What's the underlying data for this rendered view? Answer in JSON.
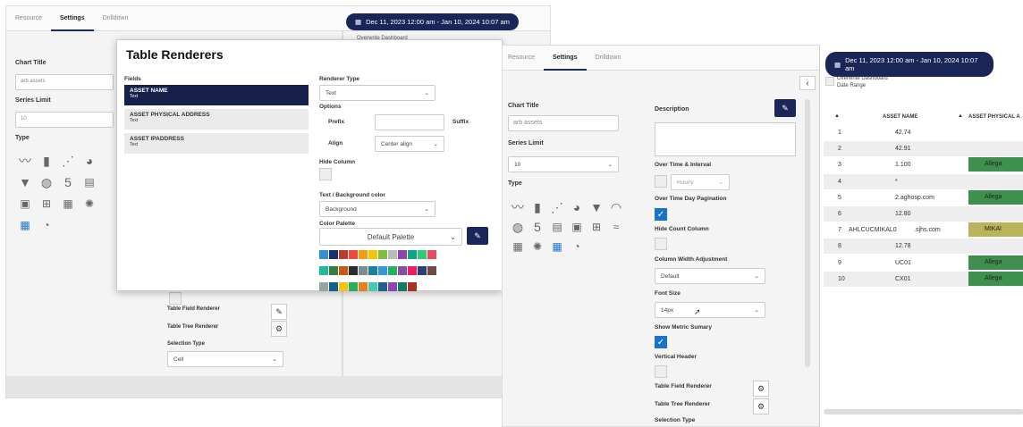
{
  "back": {
    "tabs": [
      "Resource",
      "Settings",
      "Drilldown"
    ],
    "date_range": "Dec 11, 2023 12:00 am - Jan 10, 2024 10:07 am",
    "overwrite": "Overwrite Dashboard",
    "chart_title_label": "Chart Title",
    "chart_title_value": "arb assets",
    "series_limit_label": "Series Limit",
    "series_limit_value": "10",
    "type_label": "Type",
    "table_field_renderer": "Table Field Renderer",
    "table_tree_renderer": "Table Tree Renderer",
    "selection_type": "Selection Type",
    "selection_value": "Cell"
  },
  "modal": {
    "title": "Table Renderers",
    "fields_label": "Fields",
    "fields": [
      {
        "name": "ASSET NAME",
        "type": "Text"
      },
      {
        "name": "ASSET PHYSICAL ADDRESS",
        "type": "Text"
      },
      {
        "name": "ASSET IPADDRESS",
        "type": "Text"
      }
    ],
    "renderer_type_label": "Renderer Type",
    "renderer_type_value": "Text",
    "options_label": "Options",
    "prefix_label": "Prefix",
    "suffix_label": "Suffix",
    "align_label": "Align",
    "align_value": "Center align",
    "hide_column_label": "Hide Column",
    "text_bg_label": "Text / Background color",
    "text_bg_value": "Background",
    "color_palette_label": "Color Palette",
    "palette_value": "Default Palette",
    "swatches": [
      "#2f8fd8",
      "#1b2f6e",
      "#c0392b",
      "#e74c3c",
      "#f39c12",
      "#f1c40f",
      "#7cbf3a",
      "#bbbbbb",
      "#8e44ad",
      "#16a085",
      "#2ecc71",
      "#e84a5f",
      "#1abc9c",
      "#3a7d44",
      "#c85a17",
      "#2b2b2b",
      "#7f8c8d",
      "#1e7f9e",
      "#3498db",
      "#27ae60",
      "#884ea0",
      "#e91e63",
      "#2d3e75",
      "#6d4c41",
      "#95a5a6",
      "#16618a",
      "#f1c40f",
      "#27ae60",
      "#e67e22",
      "#48c9b0",
      "#1f618d",
      "#8e44ad",
      "#117a65",
      "#a93226"
    ]
  },
  "front": {
    "tabs": [
      "Resource",
      "Settings",
      "Drilldown"
    ],
    "chart_title_label": "Chart Title",
    "chart_title_value": "arb assets",
    "series_limit_label": "Series Limit",
    "series_limit_value": "10",
    "type_label": "Type",
    "description_label": "Description",
    "over_time_label": "Over Time & Interval",
    "interval_value": "Hourly",
    "pagination_label": "Over Time Day Pagination",
    "hide_count_label": "Hide Count Column",
    "col_width_label": "Column Width Adjustment",
    "col_width_value": "Default",
    "font_size_label": "Font Size",
    "font_size_value": "14px",
    "show_metric_label": "Show Metric Sumary",
    "vertical_header_label": "Vertical Header",
    "table_field_renderer": "Table Field Renderer",
    "table_tree_renderer": "Table Tree Renderer",
    "selection_type": "Selection Type"
  },
  "right": {
    "date_range": "Dec 11, 2023 12:00 am - Jan 10, 2024 10:07 am",
    "overwrite": "Overwrite Dashboard",
    "date_range_label": "Date Range",
    "col_asset_name": "ASSET NAME",
    "col_asset_phys": "ASSET PHYSICAL A",
    "rows": [
      {
        "n": "1",
        "name": "42.74",
        "tag": ""
      },
      {
        "n": "2",
        "name": "42.91",
        "tag": ""
      },
      {
        "n": "3",
        "name": "1.100",
        "tag": "Allega"
      },
      {
        "n": "4",
        "name": "*",
        "tag": ""
      },
      {
        "n": "5",
        "name": "2.aghosp.com",
        "tag": "Allega"
      },
      {
        "n": "6",
        "name": "12.80",
        "tag": ""
      },
      {
        "n": "7",
        "name": "AHLCUCMIKAL0          .sjhs.com",
        "tag": "MIKAl"
      },
      {
        "n": "8",
        "name": "12.78",
        "tag": ""
      },
      {
        "n": "9",
        "name": "UC01",
        "tag": "Allega"
      },
      {
        "n": "10",
        "name": "CX01",
        "tag": "Allega"
      }
    ]
  },
  "colors": {
    "navy": "#1b2658",
    "green": "#3f8f4f",
    "olive": "#b8b45a",
    "check": "#1a73c8"
  }
}
